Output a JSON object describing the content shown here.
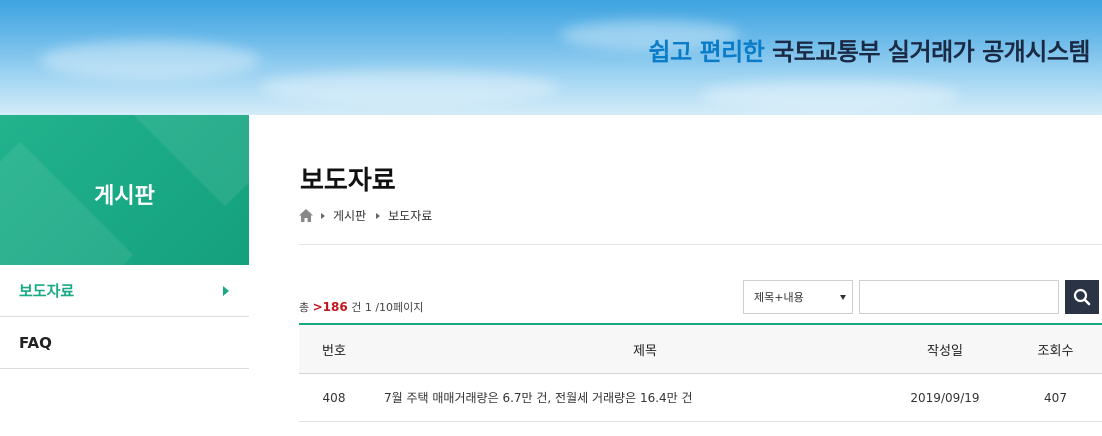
{
  "banner": {
    "highlight": "쉽고 편리한",
    "title": "국토교통부 실거래가 공개시스템"
  },
  "sidebar": {
    "heading": "게시판",
    "items": [
      {
        "label": "보도자료",
        "active": true
      },
      {
        "label": "FAQ",
        "active": false
      }
    ]
  },
  "page": {
    "title": "보도자료",
    "breadcrumb": [
      "게시판",
      "보도자료"
    ]
  },
  "list_info": {
    "prefix": "총",
    "total": ">186",
    "suffix": "건 1 /10페이지"
  },
  "search": {
    "select_value": "제목+내용",
    "input_value": ""
  },
  "table": {
    "headers": {
      "no": "번호",
      "title": "제목",
      "date": "작성일",
      "views": "조회수"
    },
    "rows": [
      {
        "no": "408",
        "title": "7월 주택 매매거래량은 6.7만 건, 전월세 거래량은 16.4만 건",
        "date": "2019/09/19",
        "views": "407"
      }
    ]
  },
  "colors": {
    "accent": "#1aa985",
    "count_highlight": "#c0161d",
    "search_button": "#2b3444"
  },
  "icons": [
    "home-icon",
    "search-icon",
    "chevron-right-icon",
    "dropdown-caret-icon"
  ]
}
